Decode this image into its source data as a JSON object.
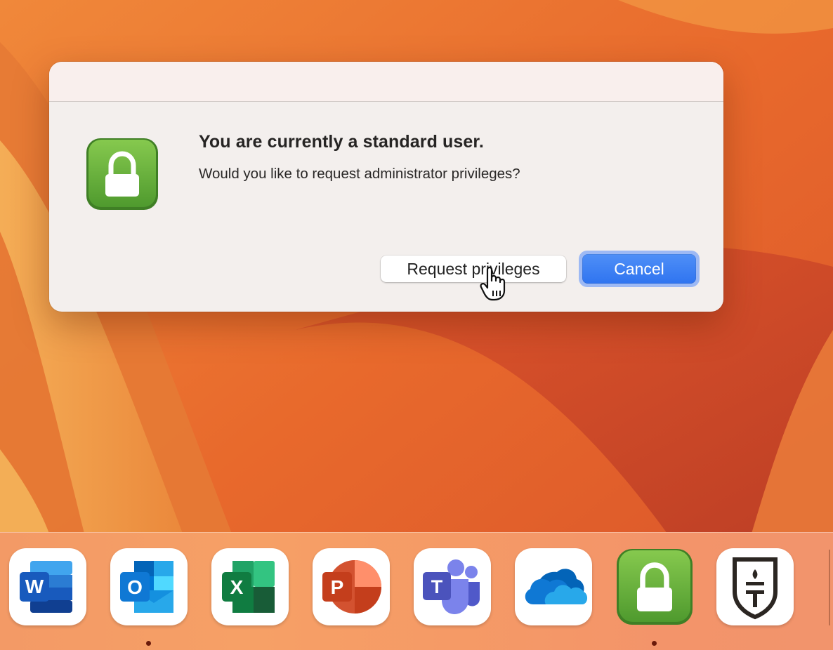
{
  "dialog": {
    "title": "You are currently a standard user.",
    "message": "Would you like to request administrator privileges?",
    "icon": "lock-icon",
    "buttons": {
      "request_label": "Request privileges",
      "cancel_label": "Cancel"
    }
  },
  "dock": {
    "items": [
      {
        "name": "Microsoft Word",
        "icon": "word-icon",
        "glyph": "W",
        "running": false
      },
      {
        "name": "Microsoft Outlook",
        "icon": "outlook-icon",
        "glyph": "O",
        "running": true
      },
      {
        "name": "Microsoft Excel",
        "icon": "excel-icon",
        "glyph": "X",
        "running": false
      },
      {
        "name": "Microsoft PowerPoint",
        "icon": "powerpoint-icon",
        "glyph": "P",
        "running": false
      },
      {
        "name": "Microsoft Teams",
        "icon": "teams-icon",
        "glyph": "T",
        "running": false
      },
      {
        "name": "OneDrive",
        "icon": "onedrive-icon",
        "running": false
      },
      {
        "name": "Privileges",
        "icon": "lock-icon",
        "running": true
      },
      {
        "name": "Self Service",
        "icon": "shield-torch-icon",
        "glyph": "T",
        "running": false
      }
    ]
  },
  "colors": {
    "accent": "#2f74f0",
    "lock_green": "#5da83a",
    "wallpaper": "#e8702f"
  }
}
